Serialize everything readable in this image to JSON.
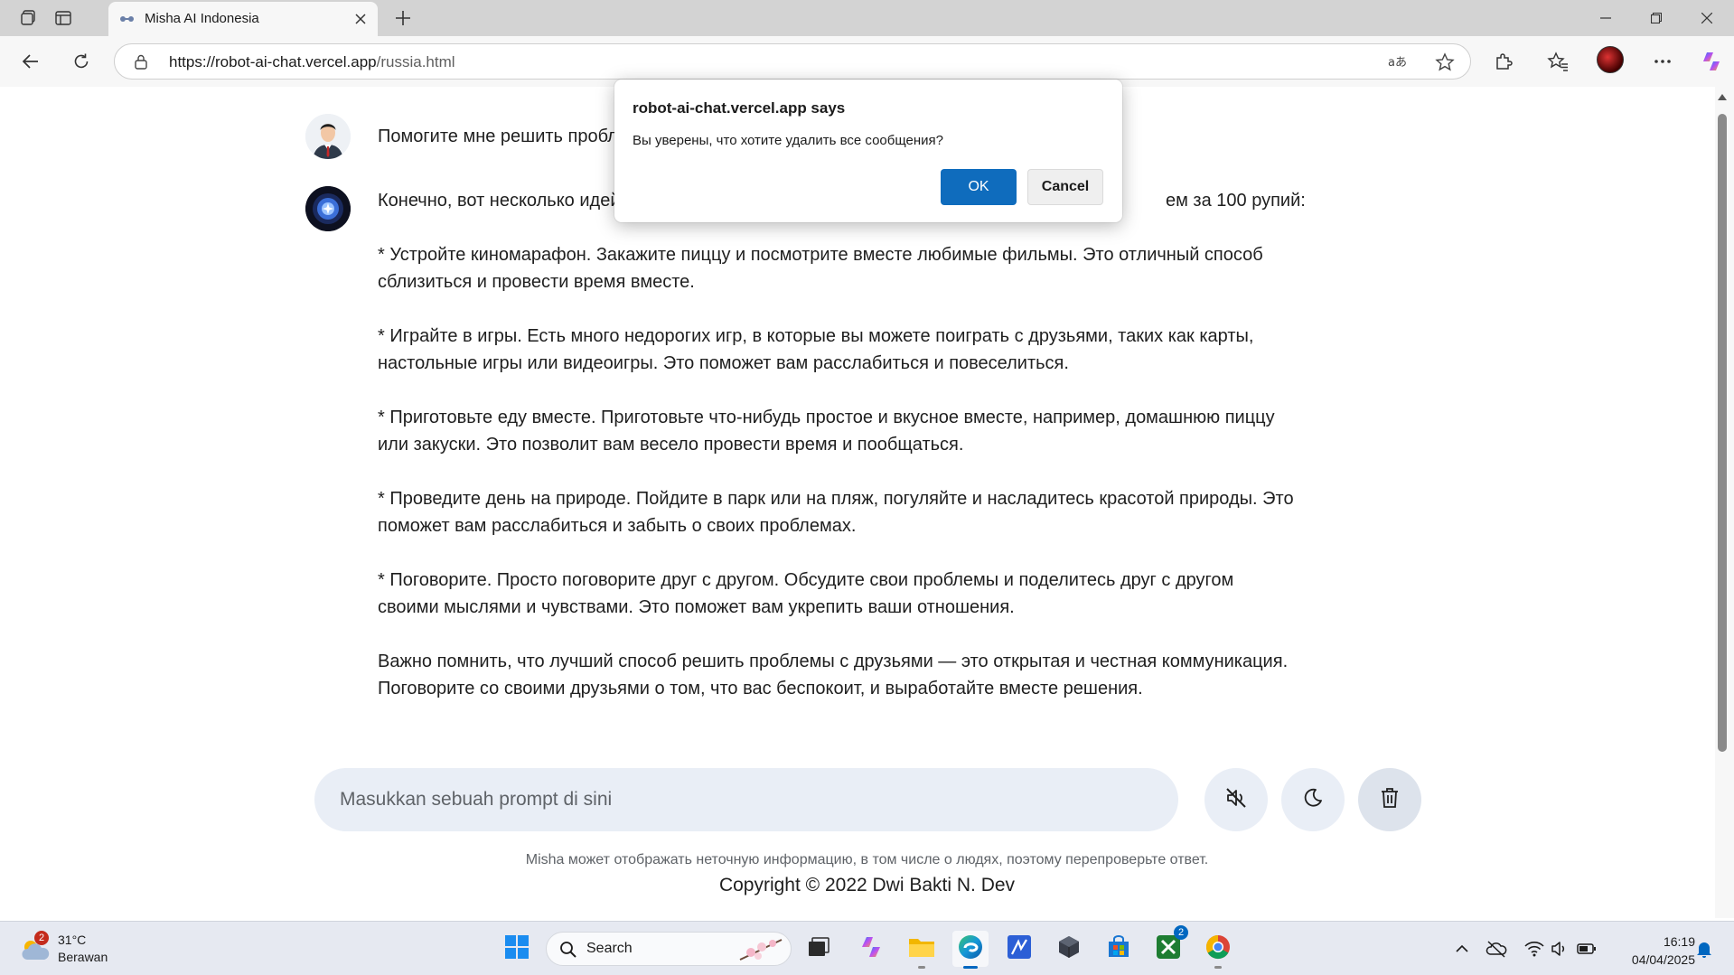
{
  "browser": {
    "tab_title": "Misha AI Indonesia",
    "url_domain": "https://robot-ai-chat.vercel.app",
    "url_path": "/russia.html"
  },
  "chat": {
    "user_message": "Помогите мне решить пробл",
    "bot_intro_left": "Конечно, вот несколько идей",
    "bot_intro_right": "ем за 100 рупий:",
    "bot_paragraphs": [
      "* Устройте киномарафон. Закажите пиццу и посмотрите вместе любимые фильмы. Это отличный способ сблизиться и провести время вместе.",
      "* Играйте в игры. Есть много недорогих игр, в которые вы можете поиграть с друзьями, таких как карты, настольные игры или видеоигры. Это поможет вам расслабиться и повеселиться.",
      "* Приготовьте еду вместе. Приготовьте что-нибудь простое и вкусное вместе, например, домашнюю пиццу или закуски. Это позволит вам весело провести время и пообщаться.",
      "* Проведите день на природе. Пойдите в парк или на пляж, погуляйте и насладитесь красотой природы. Это поможет вам расслабиться и забыть о своих проблемах.",
      "* Поговорите. Просто поговорите друг с другом. Обсудите свои проблемы и поделитесь друг с другом своими мыслями и чувствами. Это поможет вам укрепить ваши отношения.",
      "Важно помнить, что лучший способ решить проблемы с друзьями — это открытая и честная коммуникация. Поговорите со своими друзьями о том, что вас беспокоит, и выработайте вместе решения."
    ]
  },
  "input": {
    "placeholder": "Masukkan sebuah prompt di sini"
  },
  "footer": {
    "disclaimer": "Misha может отображать неточную информацию, в том числе о людях, поэтому перепроверьте ответ.",
    "copyright": "Copyright © 2022 Dwi Bakti N. Dev"
  },
  "dialog": {
    "title": "robot-ai-chat.vercel.app says",
    "message": "Вы уверены, что хотите удалить все сообщения?",
    "ok_label": "OK",
    "cancel_label": "Cancel"
  },
  "taskbar": {
    "weather_badge": "2",
    "temperature": "31°C",
    "condition": "Berawan",
    "search_label": "Search",
    "xbox_badge": "2",
    "time": "16:19",
    "date": "04/04/2025"
  },
  "icons": {
    "tab_actions": "workspaces-icon",
    "vertical_tabs": "vertical-tabs-icon",
    "back": "back-arrow-icon",
    "refresh": "refresh-icon",
    "lock": "lock-icon",
    "read_aloud": "read-aloud-icon",
    "favorite": "star-icon",
    "extensions": "puzzle-icon",
    "favorites": "favorites-icon",
    "more": "more-icon",
    "copilot": "copilot-icon",
    "mute": "volume-off-icon",
    "theme": "moon-icon",
    "delete": "trash-icon"
  },
  "colors": {
    "accent": "#0f6cbd",
    "prompt_bg": "#e9eef6"
  }
}
